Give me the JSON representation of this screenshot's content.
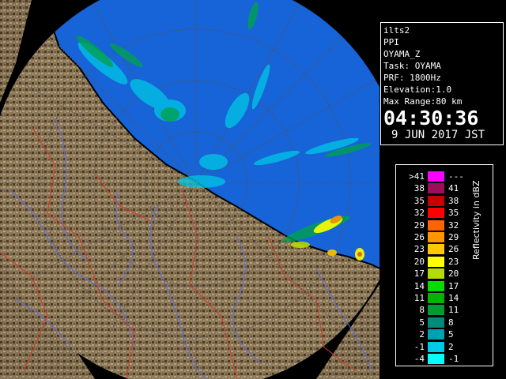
{
  "info": {
    "product": "ilts2",
    "scan_type": "PPI",
    "field": "OYAMA_Z",
    "task": "Task: OYAMA",
    "prf": "PRF: 1800Hz",
    "elevation": "Elevation:1.0",
    "max_range": "Max Range:80 km",
    "time": "04:30:36",
    "date": "9 JUN 2017 JST"
  },
  "legend": {
    "title": "Reflectivity in dBZ",
    "rows": [
      {
        "left": ">41",
        "right": "---",
        "color": "#ff00ff"
      },
      {
        "left": "38",
        "right": "41",
        "color": "#9b0f5a"
      },
      {
        "left": "35",
        "right": "38",
        "color": "#c80000"
      },
      {
        "left": "32",
        "right": "35",
        "color": "#ff0000"
      },
      {
        "left": "29",
        "right": "32",
        "color": "#ff6400"
      },
      {
        "left": "26",
        "right": "29",
        "color": "#ff9600"
      },
      {
        "left": "23",
        "right": "26",
        "color": "#ffc800"
      },
      {
        "left": "20",
        "right": "23",
        "color": "#ffff00"
      },
      {
        "left": "17",
        "right": "20",
        "color": "#b4dc00"
      },
      {
        "left": "14",
        "right": "17",
        "color": "#00dc00"
      },
      {
        "left": "11",
        "right": "14",
        "color": "#00b400"
      },
      {
        "left": "8",
        "right": "11",
        "color": "#009b32"
      },
      {
        "left": "5",
        "right": "8",
        "color": "#008c78"
      },
      {
        "left": "2",
        "right": "5",
        "color": "#00a0b4"
      },
      {
        "left": "-1",
        "right": "2",
        "color": "#00c8e6"
      },
      {
        "left": "-4",
        "right": "-1",
        "color": "#00ffff"
      }
    ]
  },
  "colors": {
    "sea": "#1763d8",
    "terrain": "#8a7658",
    "outside": "#000000"
  }
}
